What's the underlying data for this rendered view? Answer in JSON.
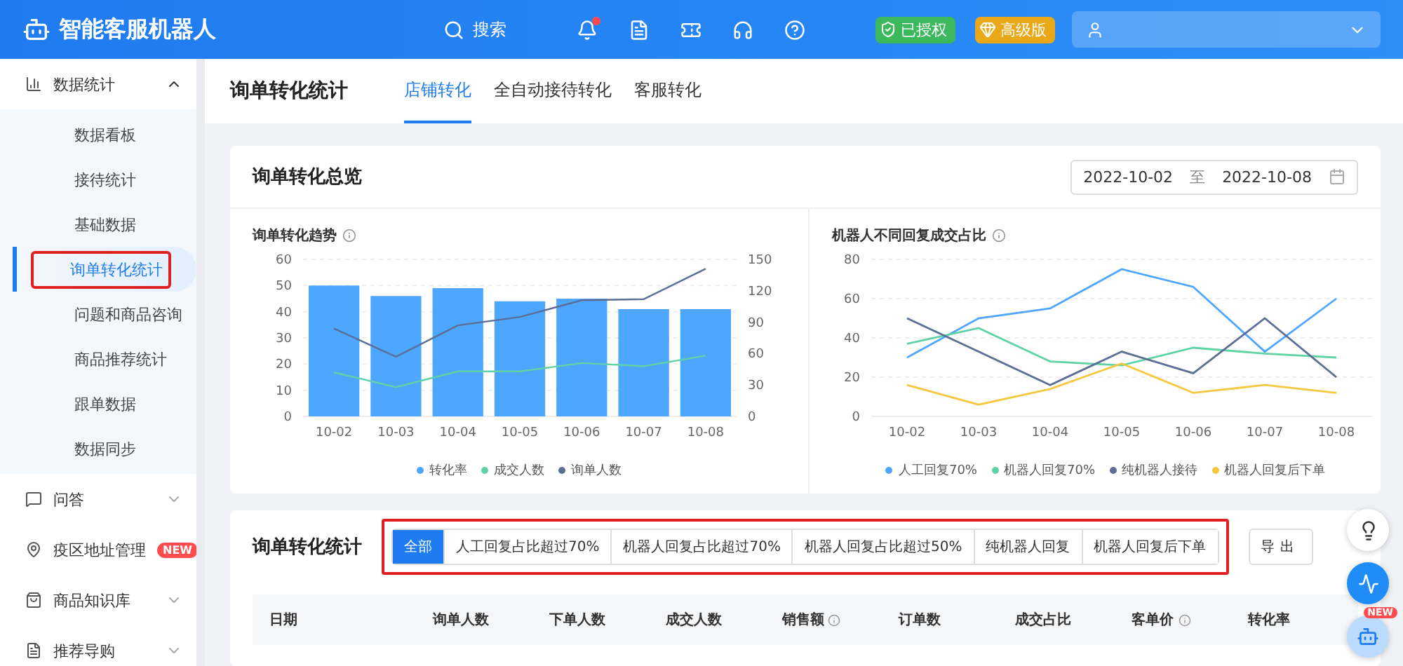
{
  "header": {
    "app_title": "智能客服机器人",
    "search_label": "搜索",
    "notification_dot": true,
    "badges": [
      {
        "label": "已授权",
        "color": "#3cb95c"
      },
      {
        "label": "高级版",
        "color": "#e8a817"
      }
    ]
  },
  "sidebar": {
    "items": [
      {
        "label": "数据统计",
        "expanded": true,
        "children": [
          {
            "label": "数据看板",
            "selected": false,
            "annotated": false
          },
          {
            "label": "接待统计",
            "selected": false,
            "annotated": false
          },
          {
            "label": "基础数据",
            "selected": false,
            "annotated": false
          },
          {
            "label": "询单转化统计",
            "selected": true,
            "annotated": true
          },
          {
            "label": "问题和商品咨询",
            "selected": false,
            "annotated": false
          },
          {
            "label": "商品推荐统计",
            "selected": false,
            "annotated": false
          },
          {
            "label": "跟单数据",
            "selected": false,
            "annotated": false
          },
          {
            "label": "数据同步",
            "selected": false,
            "annotated": false
          }
        ]
      },
      {
        "label": "问答",
        "expanded": false
      },
      {
        "label": "疫区地址管理",
        "badge": "NEW"
      },
      {
        "label": "商品知识库",
        "expanded": false
      },
      {
        "label": "推荐导购",
        "expanded": false
      }
    ]
  },
  "page": {
    "title": "询单转化统计",
    "tabs": [
      {
        "label": "店铺转化",
        "selected": true
      },
      {
        "label": "全自动接待转化",
        "selected": false
      },
      {
        "label": "客服转化",
        "selected": false
      }
    ]
  },
  "overview": {
    "title": "询单转化总览",
    "date_start": "2022-10-02",
    "date_sep": "至",
    "date_end": "2022-10-08",
    "charts": [
      {
        "title": "询单转化趋势",
        "chart_data": {
          "type": "bar",
          "categories": [
            "10-02",
            "10-03",
            "10-04",
            "10-05",
            "10-06",
            "10-07",
            "10-08"
          ],
          "ylim": [
            0,
            60
          ],
          "yticks": [
            0,
            10,
            20,
            30,
            40,
            50,
            60
          ],
          "y2lim": [
            0,
            150
          ],
          "y2ticks": [
            0,
            30,
            60,
            90,
            120,
            150
          ],
          "series": [
            {
              "name": "转化率",
              "color": "#4da6ff",
              "type": "bar",
              "values": [
                50,
                46,
                49,
                44,
                45,
                41,
                41
              ]
            },
            {
              "name": "成交人数",
              "color": "#5fd3a6",
              "type": "line",
              "axis": "y2",
              "values": [
                42,
                28,
                43,
                43,
                51,
                48,
                58
              ]
            },
            {
              "name": "询单人数",
              "color": "#5b6e96",
              "type": "line",
              "axis": "y2",
              "values": [
                84,
                57,
                87,
                95,
                111,
                112,
                141
              ]
            }
          ],
          "grid": true
        }
      },
      {
        "title": "机器人不同回复成交占比",
        "chart_data": {
          "type": "line",
          "categories": [
            "10-02",
            "10-03",
            "10-04",
            "10-05",
            "10-06",
            "10-07",
            "10-08"
          ],
          "ylim": [
            0,
            80
          ],
          "yticks": [
            0,
            20,
            40,
            60,
            80
          ],
          "series": [
            {
              "name": "人工回复70%",
              "color": "#4da6ff",
              "values": [
                30,
                50,
                55,
                75,
                66,
                33,
                60
              ]
            },
            {
              "name": "机器人回复70%",
              "color": "#5fd3a6",
              "values": [
                37,
                45,
                28,
                26,
                35,
                32,
                30
              ]
            },
            {
              "name": "纯机器人接待",
              "color": "#5b6e96",
              "values": [
                50,
                33,
                16,
                33,
                22,
                50,
                20
              ]
            },
            {
              "name": "机器人回复后下单",
              "color": "#f5c842",
              "values": [
                16,
                6,
                14,
                27,
                12,
                16,
                12
              ]
            }
          ],
          "grid": true
        }
      }
    ]
  },
  "stats": {
    "title": "询单转化统计",
    "filters_annotated": true,
    "filters": [
      {
        "label": "全部",
        "selected": true
      },
      {
        "label": "人工回复占比超过70%",
        "selected": false
      },
      {
        "label": "机器人回复占比超过70%",
        "selected": false
      },
      {
        "label": "机器人回复占比超过50%",
        "selected": false
      },
      {
        "label": "纯机器人回复",
        "selected": false
      },
      {
        "label": "机器人回复后下单",
        "selected": false
      }
    ],
    "export_label": "导出",
    "columns": [
      {
        "label": "日期",
        "info": false
      },
      {
        "label": "询单人数",
        "info": false
      },
      {
        "label": "下单人数",
        "info": false
      },
      {
        "label": "成交人数",
        "info": false
      },
      {
        "label": "销售额",
        "info": true
      },
      {
        "label": "订单数",
        "info": false
      },
      {
        "label": "成交占比",
        "info": false
      },
      {
        "label": "客单价",
        "info": true
      },
      {
        "label": "转化率",
        "info": false
      }
    ]
  },
  "floating": {
    "new_badge": "NEW"
  }
}
